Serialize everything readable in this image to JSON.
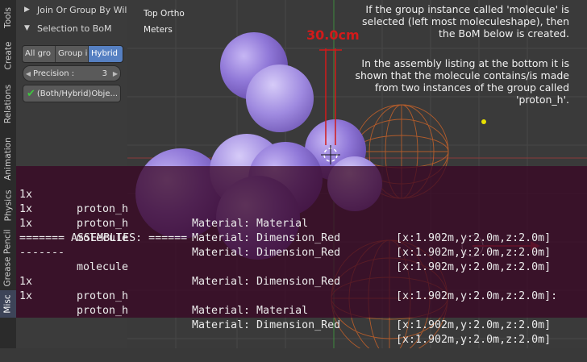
{
  "tabs": [
    "Tools",
    "Create",
    "Relations",
    "Animation",
    "Physics",
    "Grease Pencil",
    "Misc"
  ],
  "panel": {
    "section1": "Join Or Group By Wil",
    "section2": "Selection to BoM",
    "buttons": [
      "All gro",
      "Group i",
      "Hybrid"
    ],
    "precision_label": "Precision :",
    "precision_value": "3",
    "object_button": "(Both/Hybrid)Obje..."
  },
  "viewport": {
    "view_name": "Top Ortho",
    "units": "Meters",
    "dimension": "30.0cm",
    "note": [
      "If the group instance called 'molecule' is",
      "selected (left most moleculeshape), then",
      "the BoM below is created.",
      "",
      "In the assembly listing at the bottom it is",
      "shown that the molecule contains/is made",
      "from two instances of the group called",
      "'proton_h'."
    ]
  },
  "bom": {
    "rows": [
      {
        "qty": "1x",
        "name": "proton_h",
        "material": "Material: Material",
        "dims": "[x:1.902m,y:2.0m,z:2.0m]"
      },
      {
        "qty": "1x",
        "name": "proton_h",
        "material": "Material: Dimension_Red",
        "dims": "[x:1.902m,y:2.0m,z:2.0m]"
      },
      {
        "qty": "1x",
        "name": "molecule",
        "material": "Material: Dimension_Red",
        "dims": "[x:1.902m,y:2.0m,z:2.0m]"
      },
      {
        "qty": "======= ASSEMBLIES: ======",
        "name": "",
        "material": "",
        "dims": ""
      },
      {
        "qty": "-------",
        "name": "",
        "material": "",
        "dims": ""
      },
      {
        "qty": "",
        "name": "molecule",
        "material": "Material: Dimension_Red",
        "dims": "[x:1.902m,y:2.0m,z:2.0m]:"
      },
      {
        "qty": "1x",
        "name": "proton_h",
        "material": "Material: Material",
        "dims": "[x:1.902m,y:2.0m,z:2.0m]"
      },
      {
        "qty": "1x",
        "name": "proton_h",
        "material": "Material: Dimension_Red",
        "dims": "[x:1.902m,y:2.0m,z:2.0m]"
      }
    ]
  },
  "colors": {
    "accent": "#5680c2",
    "dimension_red": "#d21a1a",
    "sphere_purple": "#8f72d6",
    "wire_orange": "#c0602a",
    "grid": "#4a4a4a"
  }
}
